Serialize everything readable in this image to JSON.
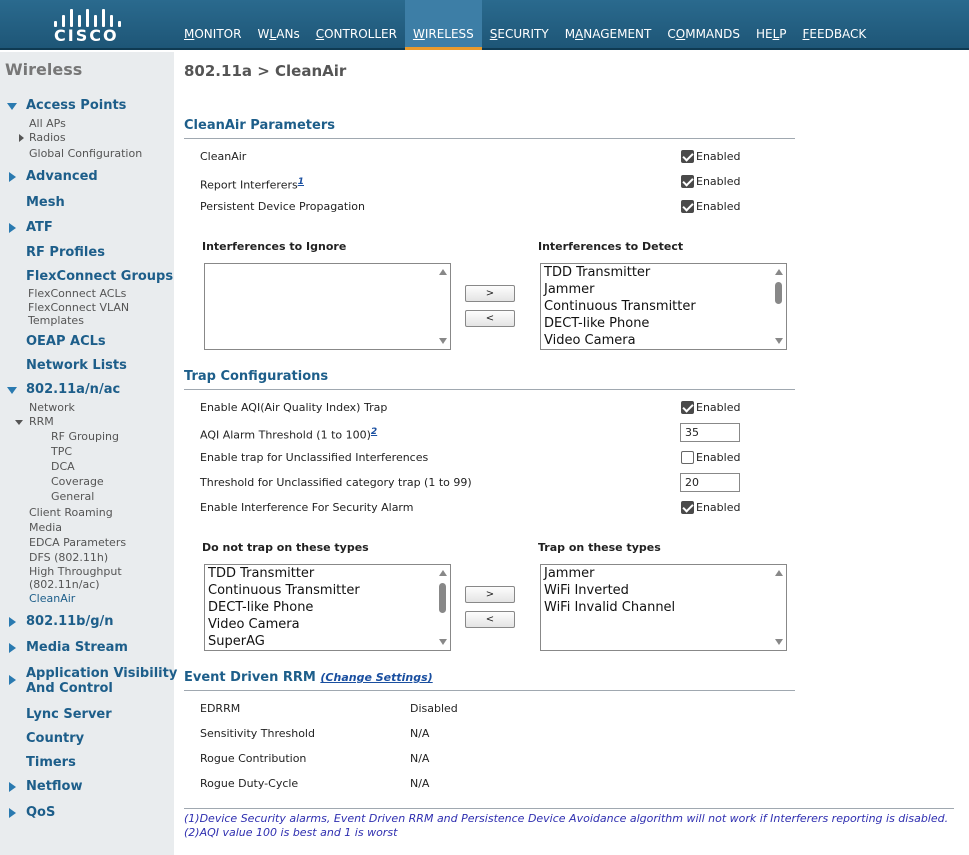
{
  "header": {
    "logo_text": "CISCO",
    "nav": [
      {
        "label": "MONITOR"
      },
      {
        "label": "WLANs"
      },
      {
        "label": "CONTROLLER"
      },
      {
        "label": "WIRELESS"
      },
      {
        "label": "SECURITY"
      },
      {
        "label": "MANAGEMENT"
      },
      {
        "label": "COMMANDS"
      },
      {
        "label": "HELP"
      },
      {
        "label": "FEEDBACK"
      }
    ],
    "active_tab": "WIRELESS"
  },
  "sidebar": {
    "title": "Wireless",
    "items": [
      {
        "label": "Access Points"
      },
      {
        "label": "All APs"
      },
      {
        "label": "Radios"
      },
      {
        "label": "Global Configuration"
      },
      {
        "label": "Advanced"
      },
      {
        "label": "Mesh"
      },
      {
        "label": "ATF"
      },
      {
        "label": "RF Profiles"
      },
      {
        "label": "FlexConnect Groups"
      },
      {
        "label": "FlexConnect ACLs"
      },
      {
        "label": "FlexConnect VLAN"
      },
      {
        "label": "Templates"
      },
      {
        "label": "OEAP ACLs"
      },
      {
        "label": "Network Lists"
      },
      {
        "label": "802.11a/n/ac"
      },
      {
        "label": "Network"
      },
      {
        "label": "RRM"
      },
      {
        "label": "RF Grouping"
      },
      {
        "label": "TPC"
      },
      {
        "label": "DCA"
      },
      {
        "label": "Coverage"
      },
      {
        "label": "General"
      },
      {
        "label": "Client Roaming"
      },
      {
        "label": "Media"
      },
      {
        "label": "EDCA Parameters"
      },
      {
        "label": "DFS (802.11h)"
      },
      {
        "label": "High Throughput"
      },
      {
        "label": "(802.11n/ac)"
      },
      {
        "label": "CleanAir"
      },
      {
        "label": "802.11b/g/n"
      },
      {
        "label": "Media Stream"
      },
      {
        "label": "Application Visibility"
      },
      {
        "label": "And Control"
      },
      {
        "label": "Lync Server"
      },
      {
        "label": "Country"
      },
      {
        "label": "Timers"
      },
      {
        "label": "Netflow"
      },
      {
        "label": "QoS"
      }
    ]
  },
  "main": {
    "page_title": "802.11a > CleanAir",
    "cleanair_section": "CleanAir Parameters",
    "cleanair_rows": [
      {
        "label": "CleanAir",
        "sup": "",
        "checked": true,
        "value": "Enabled"
      },
      {
        "label": "Report Interferers",
        "sup": "1",
        "checked": true,
        "value": "Enabled"
      },
      {
        "label": "Persistent Device Propagation",
        "sup": "",
        "checked": true,
        "value": "Enabled"
      }
    ],
    "ignore_header": "Interferences to Ignore",
    "detect_header": "Interferences to Detect",
    "ignore_list": [],
    "detect_list": [
      "TDD Transmitter",
      "Jammer",
      "Continuous Transmitter",
      "DECT-like Phone",
      "Video Camera"
    ],
    "move_right_label": ">",
    "move_left_label": "<",
    "trap_section": "Trap Configurations",
    "trap_rows": {
      "aqi_trap_label": "Enable AQI(Air Quality Index) Trap",
      "aqi_trap_value": "Enabled",
      "aqi_threshold_label": "AQI Alarm Threshold (1 to 100)",
      "aqi_threshold_sup": "2",
      "aqi_threshold_value": "35",
      "unclassified_trap_label": "Enable trap for Unclassified Interferences",
      "unclassified_trap_value": "Enabled",
      "unclassified_threshold_label": "Threshold for Unclassified category trap (1 to 99)",
      "unclassified_threshold_value": "20",
      "security_alarm_label": "Enable Interference For Security Alarm",
      "security_alarm_value": "Enabled"
    },
    "no_trap_header": "Do not trap on these types",
    "trap_header": "Trap on these types",
    "no_trap_list": [
      "TDD Transmitter",
      "Continuous Transmitter",
      "DECT-like Phone",
      "Video Camera",
      "SuperAG"
    ],
    "trap_list": [
      "Jammer",
      "WiFi Inverted",
      "WiFi Invalid Channel"
    ],
    "edrrm_section": "Event Driven RRM",
    "edrrm_link": "(Change Settings)",
    "edrrm_rows": [
      {
        "label": "EDRRM",
        "value": "Disabled"
      },
      {
        "label": "Sensitivity Threshold",
        "value": "N/A"
      },
      {
        "label": "Rogue Contribution",
        "value": "N/A"
      },
      {
        "label": "Rogue Duty-Cycle",
        "value": "N/A"
      }
    ],
    "footnotes": [
      "(1)Device Security alarms, Event Driven RRM and Persistence Device Avoidance algorithm will not work if Interferers reporting is disabled.",
      "(2)AQI value 100 is best and 1 is worst"
    ]
  }
}
